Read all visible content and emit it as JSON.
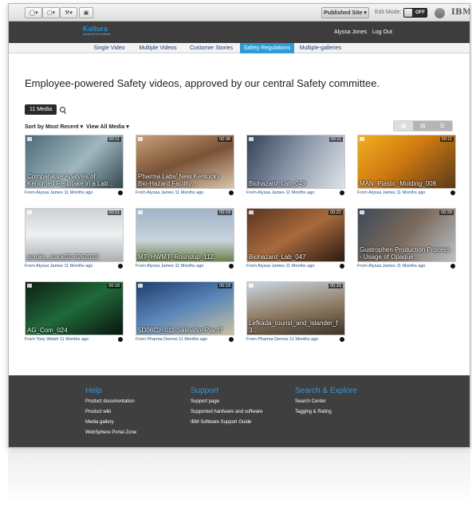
{
  "toolbar": {
    "published_label": "Published Site",
    "edit_mode_label": "Edit Mode:",
    "toggle_label": "OFF",
    "brand": "IBM"
  },
  "header": {
    "logo": "Kaltura",
    "logo_sub": "powered by Kaltura",
    "user_name": "Alyssa Jones",
    "logout": "Log Out"
  },
  "nav": {
    "items": [
      "Single Video",
      "Multiple Videos",
      "Customer Stories",
      "Safety Regulations",
      "Multiple-galleries"
    ]
  },
  "main": {
    "intro": "Employee-powered Safety videos, approved by our central Safety committee.",
    "media_count": "11 Media",
    "sort_label": "Sort by Most Recent",
    "view_label": "View All Media"
  },
  "videos": [
    {
      "title": "Comparative Analysis of Kenomed Reuptake in a Lab…",
      "duration": "00:11",
      "meta": "From Alyssa James 11 Months ago"
    },
    {
      "title": "Pharma Labs' New Kentucky Bio-Hazard Facility…",
      "duration": "00:38",
      "meta": "From Alyssa James 11 Months ago"
    },
    {
      "title": "Biohazard_Lab_049",
      "duration": "00:11",
      "meta": "From Alyssa James 11 Months ago"
    },
    {
      "title": "MAN_Plastic_Molding_008",
      "duration": "00:11",
      "meta": "From Alyssa James 11 Months ago"
    },
    {
      "title": "smoke_stack02-8262013",
      "duration": "00:11",
      "meta": "From Alyssa James 11 Months ago"
    },
    {
      "title": "MT_HWMT_Roundup_112",
      "duration": "00:19",
      "meta": "From Alyssa James 11 Months ago"
    },
    {
      "title": "Biohazard_Lab_047",
      "duration": "00:21",
      "meta": "From Alyssa James 11 Months ago"
    },
    {
      "title": "Gustrophen Production Process - Usage of Opaque…",
      "duration": "00:20",
      "meta": "From Alyssa James 11 Months ago"
    },
    {
      "title": "AG_Com_024",
      "duration": "00:18",
      "meta": "From Tony Walsh 11 Months ago"
    },
    {
      "title": "5D08CJ_011-SalinationPlant7",
      "duration": "00:19",
      "meta": "From Pharma Demos 11 Months ago"
    },
    {
      "title": "Lefkada_tourist_and_islander_f 3…",
      "duration": "00:15",
      "meta": "From Pharma Demos 11 Months ago"
    }
  ],
  "footer": {
    "help": {
      "title": "Help",
      "links": [
        "Product documentation",
        "Product wiki",
        "Media gallery",
        "WebSphere Portal Zone"
      ]
    },
    "support": {
      "title": "Support",
      "links": [
        "Support page",
        "Supported hardware and software",
        "IBM Software Support Guide"
      ]
    },
    "search": {
      "title": "Search & Explore",
      "links": [
        "Search Center",
        "Tagging & Rating"
      ]
    }
  }
}
